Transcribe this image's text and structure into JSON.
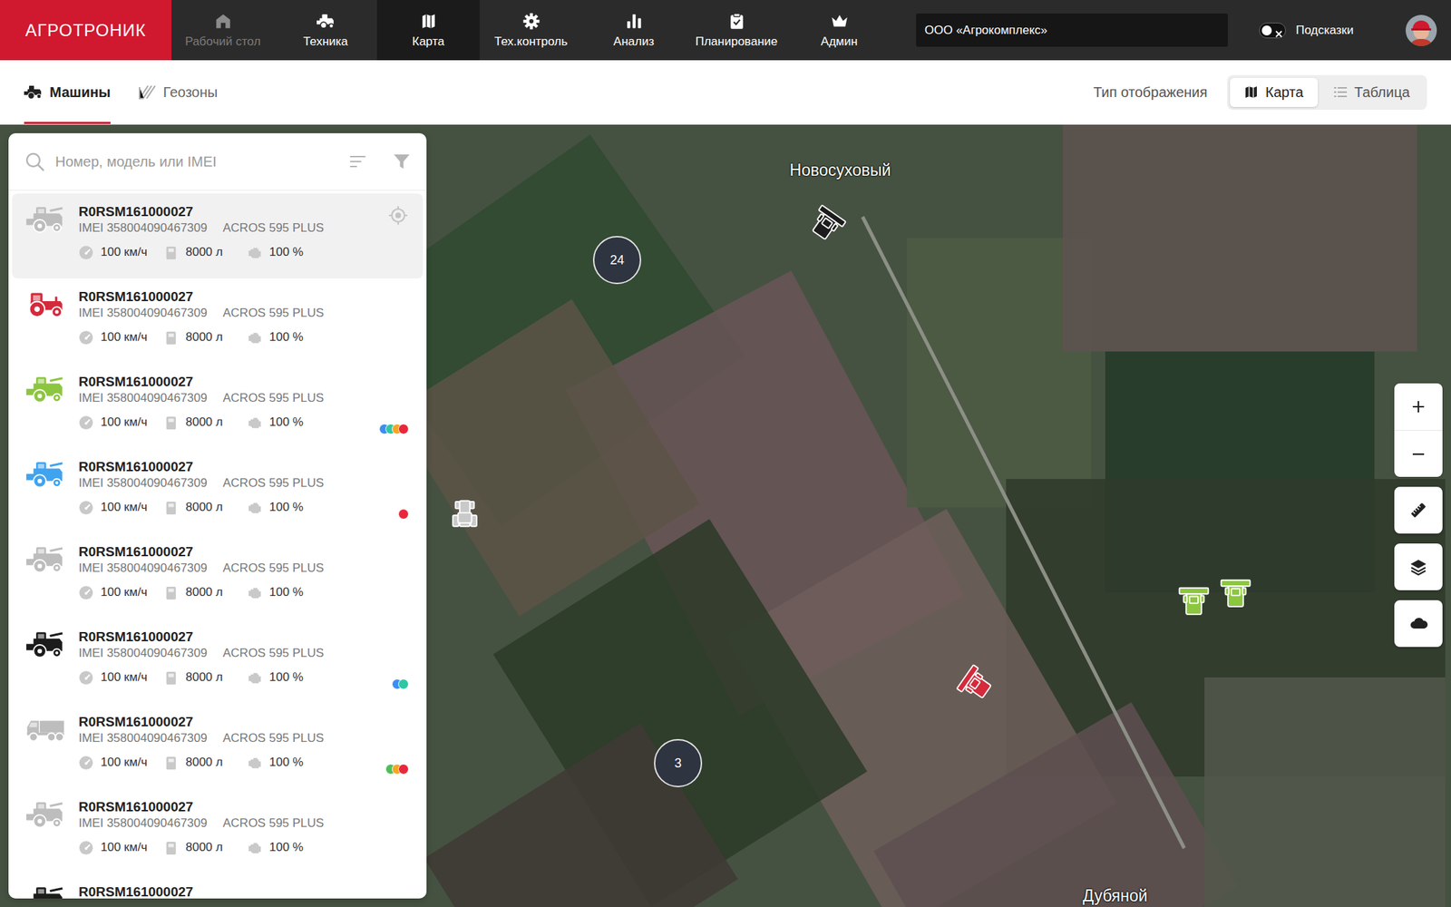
{
  "logo": "АГРОТРОНИК",
  "nav": [
    {
      "label": "Рабочий стол",
      "icon": "home",
      "selected": false,
      "disabled": true
    },
    {
      "label": "Техника",
      "icon": "machine",
      "selected": false,
      "disabled": false
    },
    {
      "label": "Карта",
      "icon": "map",
      "selected": true,
      "disabled": false
    },
    {
      "label": "Тех.контроль",
      "icon": "gear",
      "selected": false,
      "disabled": false
    },
    {
      "label": "Анализ",
      "icon": "chart",
      "selected": false,
      "disabled": false
    },
    {
      "label": "Планирование",
      "icon": "clipboard",
      "selected": false,
      "disabled": false
    },
    {
      "label": "Админ",
      "icon": "crown",
      "selected": false,
      "disabled": false
    }
  ],
  "company": "ООО «Агрокомплекс»",
  "hints": {
    "label": "Подсказки",
    "on": false
  },
  "subtabs": [
    {
      "label": "Машины",
      "selected": true
    },
    {
      "label": "Геозоны",
      "selected": false
    }
  ],
  "view": {
    "label": "Тип отображения",
    "options": [
      {
        "label": "Карта",
        "selected": true
      },
      {
        "label": "Таблица",
        "selected": false
      }
    ]
  },
  "search": {
    "placeholder": "Номер, модель или IMEI"
  },
  "machines": [
    {
      "number": "R0RSM161000027",
      "imei": "IMEI 358004090467309",
      "model": "ACROS 595 PLUS",
      "speed": "100 км/ч",
      "fuel": "8000 л",
      "engine": "100 %",
      "kind": "combine",
      "color": "#bdbdbd",
      "selected": true,
      "statuses": []
    },
    {
      "number": "R0RSM161000027",
      "imei": "IMEI 358004090467309",
      "model": "ACROS 595 PLUS",
      "speed": "100 км/ч",
      "fuel": "8000 л",
      "engine": "100 %",
      "kind": "tractor",
      "color": "#d42a3c",
      "selected": false,
      "statuses": []
    },
    {
      "number": "R0RSM161000027",
      "imei": "IMEI 358004090467309",
      "model": "ACROS 595 PLUS",
      "speed": "100 км/ч",
      "fuel": "8000 л",
      "engine": "100 %",
      "kind": "combine",
      "color": "#8cc63f",
      "selected": false,
      "statuses": [
        {
          "color": "#3d8ef0"
        },
        {
          "color": "#2fc6a4"
        },
        {
          "color": "#f5a623"
        },
        {
          "color": "#e8283a"
        }
      ]
    },
    {
      "number": "R0RSM161000027",
      "imei": "IMEI 358004090467309",
      "model": "ACROS 595 PLUS",
      "speed": "100 км/ч",
      "fuel": "8000 л",
      "engine": "100 %",
      "kind": "combine",
      "color": "#3fa3f0",
      "selected": false,
      "statuses": [
        {
          "color": "#e8283a"
        }
      ]
    },
    {
      "number": "R0RSM161000027",
      "imei": "IMEI 358004090467309",
      "model": "ACROS 595 PLUS",
      "speed": "100 км/ч",
      "fuel": "8000 л",
      "engine": "100 %",
      "kind": "combine",
      "color": "#bdbdbd",
      "selected": false,
      "statuses": []
    },
    {
      "number": "R0RSM161000027",
      "imei": "IMEI 358004090467309",
      "model": "ACROS 595 PLUS",
      "speed": "100 км/ч",
      "fuel": "8000 л",
      "engine": "100 %",
      "kind": "combine",
      "color": "#1c1c1c",
      "selected": false,
      "statuses": [
        {
          "color": "#3d8ef0"
        },
        {
          "color": "#2fc6a4"
        }
      ]
    },
    {
      "number": "R0RSM161000027",
      "imei": "IMEI 358004090467309",
      "model": "ACROS 595 PLUS",
      "speed": "100 км/ч",
      "fuel": "8000 л",
      "engine": "100 %",
      "kind": "truck",
      "color": "#bdbdbd",
      "selected": false,
      "statuses": [
        {
          "color": "#4cbf5a"
        },
        {
          "color": "#f5a623"
        },
        {
          "color": "#e8283a"
        }
      ]
    },
    {
      "number": "R0RSM161000027",
      "imei": "IMEI 358004090467309",
      "model": "ACROS 595 PLUS",
      "speed": "100 км/ч",
      "fuel": "8000 л",
      "engine": "100 %",
      "kind": "combine",
      "color": "#bdbdbd",
      "selected": false,
      "statuses": []
    },
    {
      "number": "R0RSM161000027",
      "kind": "combine",
      "color": "#1c1c1c",
      "selected": false,
      "statuses": []
    }
  ],
  "map": {
    "labels": [
      "Новосуховый",
      "Дубяной"
    ],
    "clusters": [
      {
        "count": "24"
      },
      {
        "count": "3"
      }
    ],
    "pins": [
      {
        "kind": "combine",
        "color": "#1c1c1c"
      },
      {
        "kind": "tractor",
        "color": "#c9c9c9"
      },
      {
        "kind": "combine",
        "color": "#8cc63f"
      },
      {
        "kind": "combine",
        "color": "#8cc63f"
      },
      {
        "kind": "combine",
        "color": "#d42a3c"
      }
    ]
  }
}
